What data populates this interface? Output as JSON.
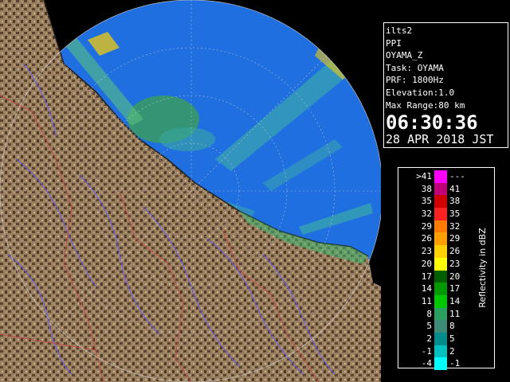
{
  "info": {
    "radar_id": "ilts2",
    "product": "PPI",
    "site": "OYAMA_Z",
    "task": "Task: OYAMA",
    "prf": "PRF: 1800Hz",
    "elevation": "Elevation:1.0",
    "max_range": "Max Range:80 km",
    "time": "06:30:36",
    "date": "28 APR 2018 JST"
  },
  "legend": {
    "title": "Reflectivity in dBZ",
    "rows": [
      {
        "lo": ">41",
        "hi": "---",
        "color": "#ff00ff"
      },
      {
        "lo": "38",
        "hi": "41",
        "color": "#c0007a"
      },
      {
        "lo": "35",
        "hi": "38",
        "color": "#d00000"
      },
      {
        "lo": "32",
        "hi": "35",
        "color": "#ff2020"
      },
      {
        "lo": "29",
        "hi": "32",
        "color": "#ff7a00"
      },
      {
        "lo": "26",
        "hi": "29",
        "color": "#ffa000"
      },
      {
        "lo": "23",
        "hi": "26",
        "color": "#ffd000"
      },
      {
        "lo": "20",
        "hi": "23",
        "color": "#ffff00"
      },
      {
        "lo": "17",
        "hi": "20",
        "color": "#006000"
      },
      {
        "lo": "14",
        "hi": "17",
        "color": "#009a00"
      },
      {
        "lo": "11",
        "hi": "14",
        "color": "#00c800"
      },
      {
        "lo": "8",
        "hi": "11",
        "color": "#2aa060"
      },
      {
        "lo": "5",
        "hi": "8",
        "color": "#3c8a78"
      },
      {
        "lo": "2",
        "hi": "5",
        "color": "#008c8c"
      },
      {
        "lo": "-1",
        "hi": "2",
        "color": "#00c0c0"
      },
      {
        "lo": "-4",
        "hi": "-1",
        "color": "#00ffff"
      }
    ]
  },
  "colors": {
    "background": "#000000",
    "sea_echo": "#1f6fe0",
    "land": "#9a8060",
    "land_dark": "#4e3a26",
    "rivers": "#6a5af0",
    "boundaries": "#c04848",
    "range_rings": "#cfcfcf"
  },
  "icons": {
    "radar": "radar-ppi-display"
  }
}
